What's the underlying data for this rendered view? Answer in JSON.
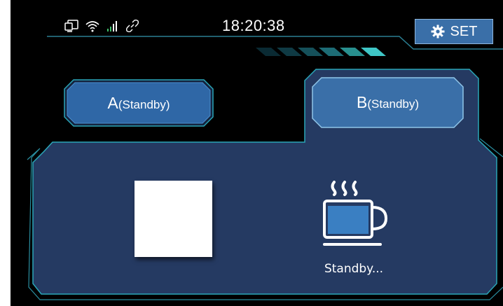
{
  "status_bar": {
    "icons": [
      "display-icon",
      "wifi-icon",
      "signal-icon",
      "link-icon"
    ],
    "time": "18:20:38"
  },
  "settings_button": {
    "label": "SET",
    "icon": "gear-icon"
  },
  "tabs": [
    {
      "name": "A",
      "state": "(Standby)"
    },
    {
      "name": "B",
      "state": "(Standby)"
    }
  ],
  "panel": {
    "status_icon": "coffee-cup-icon",
    "status_text": "Standby..."
  },
  "colors": {
    "background": "#000000",
    "panel": "#253a62",
    "button": "#3a6fa8",
    "outline": "#2aa6b8",
    "accent": "#3fc6c6"
  }
}
